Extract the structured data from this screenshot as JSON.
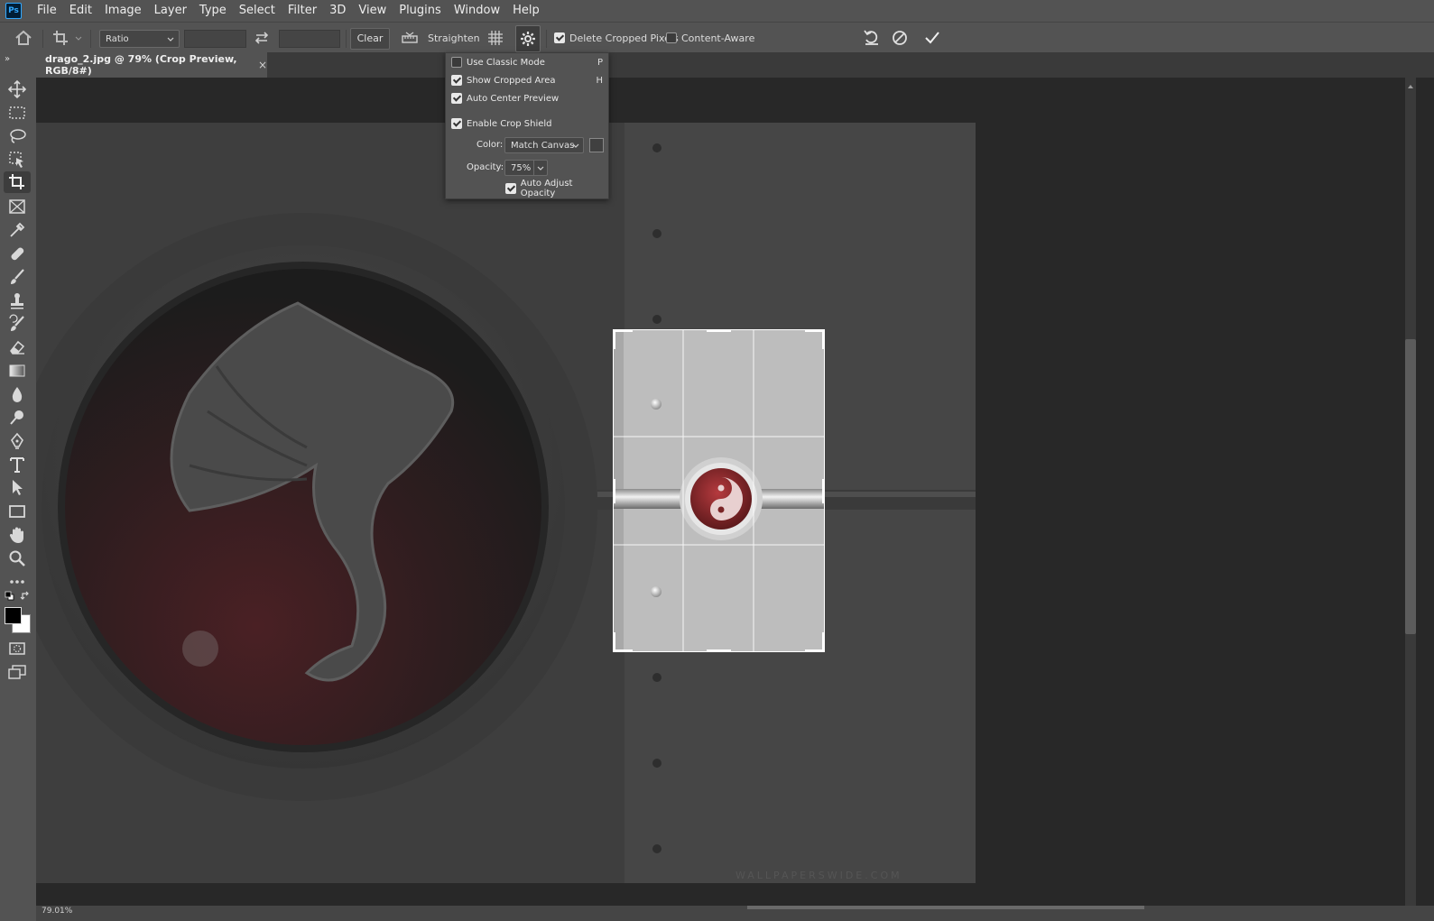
{
  "app": {
    "logo": "Ps"
  },
  "menu": [
    "File",
    "Edit",
    "Image",
    "Layer",
    "Type",
    "Select",
    "Filter",
    "3D",
    "View",
    "Plugins",
    "Window",
    "Help"
  ],
  "options": {
    "ratio_select": "Ratio",
    "clear_label": "Clear",
    "straighten_label": "Straighten",
    "delete_cropped_label": "Delete Cropped Pixels",
    "delete_cropped_checked": true,
    "content_aware_label": "Content-Aware",
    "content_aware_checked": false
  },
  "document_tab": {
    "title": "drago_2.jpg @ 79% (Crop Preview, RGB/8#)",
    "close": "×"
  },
  "crop_settings": {
    "use_classic_mode": {
      "label": "Use Classic Mode",
      "checked": false,
      "hotkey": "P"
    },
    "show_cropped_area": {
      "label": "Show Cropped Area",
      "checked": true,
      "hotkey": "H"
    },
    "auto_center_preview": {
      "label": "Auto Center Preview",
      "checked": true
    },
    "enable_crop_shield": {
      "label": "Enable Crop Shield",
      "checked": true
    },
    "color_label": "Color:",
    "color_value": "Match Canvas",
    "opacity_label": "Opacity:",
    "opacity_value": "75%",
    "auto_adjust_opacity": {
      "label": "Auto Adjust Opacity",
      "checked": true
    }
  },
  "canvas": {
    "watermark": "WALLPAPERSWIDE.COM"
  },
  "status_bar": {
    "zoom": "79.01%"
  },
  "colors": {
    "foreground": "#000000",
    "background": "#ffffff",
    "accent": "#31a8ff"
  }
}
